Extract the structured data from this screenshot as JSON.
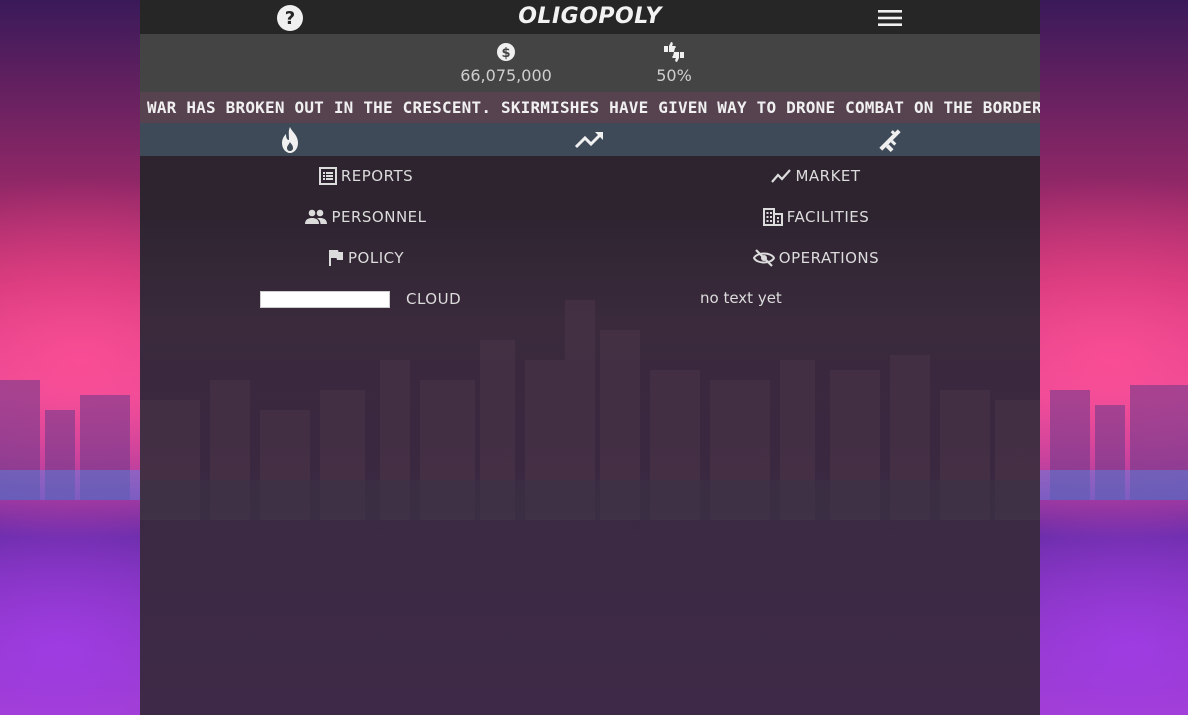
{
  "header": {
    "title": "OLIGOPOLY",
    "help_icon": "question-circle-icon",
    "menu_icon": "hamburger-menu-icon"
  },
  "stats": {
    "money": {
      "icon": "dollar-circle-icon",
      "value": "66,075,000"
    },
    "approval": {
      "icon": "thumbs-up-down-icon",
      "value": "50%"
    }
  },
  "ticker": {
    "text": "WAR HAS BROKEN OUT IN THE CRESCENT. SKIRMISHES HAVE GIVEN WAY TO DRONE COMBAT ON THE BORDER."
  },
  "tabs": [
    {
      "icon": "fire-icon"
    },
    {
      "icon": "trending-up-icon"
    },
    {
      "icon": "rifle-icon"
    }
  ],
  "nav": {
    "reports": "REPORTS",
    "market": "MARKET",
    "personnel": "PERSONNEL",
    "facilities": "FACILITIES",
    "policy": "POLICY",
    "operations": "OPERATIONS"
  },
  "cloud": {
    "input_value": "",
    "label": "CLOUD"
  },
  "note": "no text yet",
  "colors": {
    "topbar": "#262626",
    "statsbar": "#444444",
    "ticker": "#57424f",
    "tabbar": "#3f4a58",
    "text": "#dcdcdc"
  }
}
